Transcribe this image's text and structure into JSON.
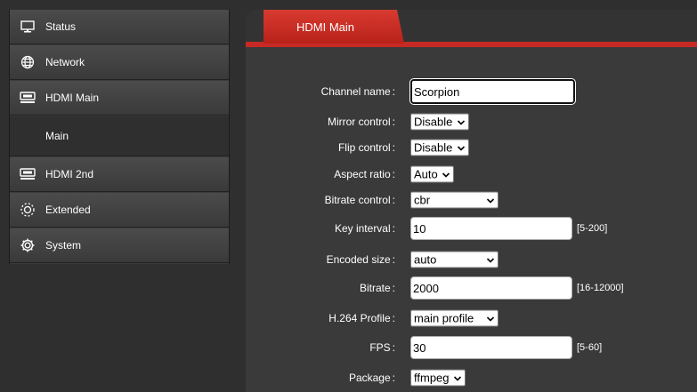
{
  "sidebar": {
    "items": [
      {
        "label": "Status",
        "icon": "monitor-icon"
      },
      {
        "label": "Network",
        "icon": "globe-icon"
      },
      {
        "label": "HDMI Main",
        "icon": "hdmi-icon"
      },
      {
        "label": "HDMI 2nd",
        "icon": "hdmi-icon"
      },
      {
        "label": "Extended",
        "icon": "sun-gear-icon"
      },
      {
        "label": "System",
        "icon": "gear-icon"
      }
    ],
    "sub_item": "Main"
  },
  "tab": {
    "label": "HDMI Main"
  },
  "form": {
    "channel_name": {
      "label": "Channel name",
      "value": "Scorpion"
    },
    "mirror": {
      "label": "Mirror control",
      "value": "Disable"
    },
    "flip": {
      "label": "Flip control",
      "value": "Disable"
    },
    "aspect": {
      "label": "Aspect ratio",
      "value": "Auto"
    },
    "bitrate_control": {
      "label": "Bitrate control",
      "value": "cbr"
    },
    "key_interval": {
      "label": "Key interval",
      "value": "10",
      "range": "[5-200]"
    },
    "encoded_size": {
      "label": "Encoded size",
      "value": "auto"
    },
    "bitrate": {
      "label": "Bitrate",
      "value": "2000",
      "range": "[16-12000]"
    },
    "profile": {
      "label": "H.264 Profile",
      "value": "main profile"
    },
    "fps": {
      "label": "FPS",
      "value": "30",
      "range": "[5-60]"
    },
    "package": {
      "label": "Package",
      "value": "ffmpeg"
    }
  },
  "colors": {
    "accent": "#c72a24",
    "panel": "#3a3a3a",
    "background": "#2f2f2f"
  }
}
